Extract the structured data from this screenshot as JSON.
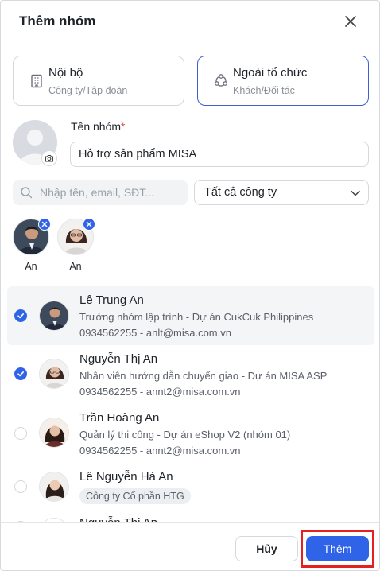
{
  "dialog": {
    "title": "Thêm nhóm"
  },
  "group_types": [
    {
      "name": "Nội bộ",
      "desc": "Công ty/Tập đoàn",
      "icon": "building-icon",
      "selected": false
    },
    {
      "name": "Ngoài tổ chức",
      "desc": "Khách/Đối tác",
      "icon": "partners-icon",
      "selected": true
    }
  ],
  "group_name": {
    "label": "Tên nhóm",
    "required_mark": "*",
    "value": "Hỗ trợ sản phẩm MISA"
  },
  "search": {
    "placeholder": "Nhập tên, email, SĐT..."
  },
  "company_filter": {
    "value": "Tất cả công ty"
  },
  "selected_members": [
    {
      "name": "An"
    },
    {
      "name": "An"
    }
  ],
  "members": [
    {
      "name": "Lê Trung An",
      "role": "Trưởng nhóm lập trình - Dự án CukCuk Philippines",
      "contact": "0934562255 - anlt@misa.com.vn",
      "checked": true
    },
    {
      "name": "Nguyễn Thị An",
      "role": "Nhân viên hướng dẫn chuyển giao - Dự án MISA ASP",
      "contact": "0934562255 - annt2@misa.com.vn",
      "checked": true
    },
    {
      "name": "Trần Hoàng An",
      "role": "Quản lý thi công - Dự án eShop V2 (nhóm 01)",
      "contact": "0934562255 - annt2@misa.com.vn",
      "checked": false
    },
    {
      "name": "Lê Nguyễn Hà An",
      "company": "Công ty Cổ phần HTG",
      "checked": false
    },
    {
      "name": "Nguyễn Thị An",
      "checked": false
    }
  ],
  "footer": {
    "cancel_label": "Hủy",
    "add_label": "Thêm"
  },
  "colors": {
    "primary": "#2f63e8",
    "highlight_outline": "#e5201e",
    "required": "#e5484d"
  }
}
